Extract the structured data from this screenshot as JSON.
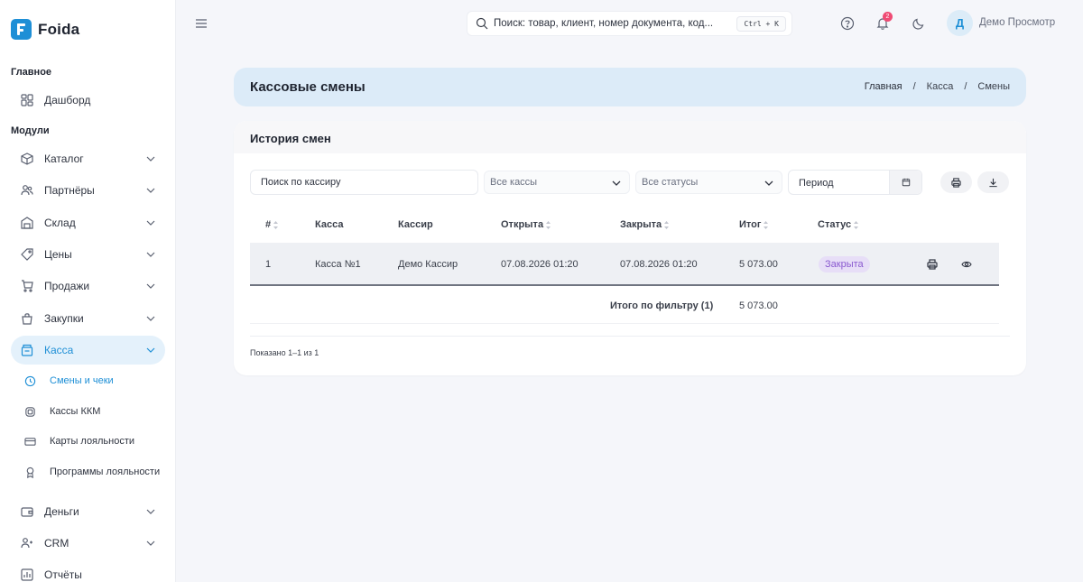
{
  "brand": {
    "name": "Foida",
    "color": "#1e8fd6"
  },
  "sidebar": {
    "section_main": "Главное",
    "dashboard": {
      "label": "Дашборд",
      "icon": "dashboard-icon"
    },
    "section_modules": "Модули",
    "items": [
      {
        "label": "Каталог",
        "icon": "box-icon"
      },
      {
        "label": "Партнёры",
        "icon": "users-icon"
      },
      {
        "label": "Склад",
        "icon": "warehouse-icon"
      },
      {
        "label": "Цены",
        "icon": "tag-icon"
      },
      {
        "label": "Продажи",
        "icon": "cart-icon"
      },
      {
        "label": "Закупки",
        "icon": "bag-icon"
      },
      {
        "label": "Касса",
        "icon": "cash-register-icon",
        "active": true
      },
      {
        "label": "Деньги",
        "icon": "wallet-icon"
      },
      {
        "label": "CRM",
        "icon": "crm-icon"
      },
      {
        "label": "Отчёты",
        "icon": "chart-icon"
      }
    ],
    "subitems": [
      {
        "label": "Смены и чеки",
        "icon": "clock-icon",
        "active": true
      },
      {
        "label": "Кассы ККМ",
        "icon": "chip-icon"
      },
      {
        "label": "Карты лояльности",
        "icon": "card-icon"
      },
      {
        "label": "Программы лояльности",
        "icon": "award-icon"
      }
    ]
  },
  "topbar": {
    "search_placeholder": "Поиск: товар, клиент, номер документа, код...",
    "search_shortcut": "Ctrl + K",
    "notifications_count": "2",
    "user_initial": "Д",
    "user_name": "Демо Просмотр"
  },
  "header": {
    "title": "Кассовые смены",
    "breadcrumb": [
      "Главная",
      "Касса",
      "Смены"
    ],
    "separator": "/"
  },
  "card": {
    "title": "История смен",
    "filters": {
      "cashier_search": "Поиск по кассиру",
      "register_select": "Все кассы",
      "status_select": "Все статусы",
      "period": "Период"
    },
    "columns": [
      "#",
      "Касса",
      "Кассир",
      "Открыта",
      "Закрыта",
      "Итог",
      "Статус"
    ],
    "rows": [
      {
        "num": "1",
        "register": "Касса №1",
        "cashier": "Демо Кассир",
        "opened": "07.08.2026 01:20",
        "closed": "07.08.2026 01:20",
        "total": "5 073.00",
        "status": "Закрыта"
      }
    ],
    "footer_total_label": "Итого по фильтру (1)",
    "footer_total_value": "5 073.00",
    "shown": "Показано 1–1 из 1"
  },
  "colors": {
    "accent": "#1e8fd6",
    "status_closed_bg": "#e7def7",
    "status_closed_text": "#8a5ad0",
    "badge": "#ef4b74"
  }
}
